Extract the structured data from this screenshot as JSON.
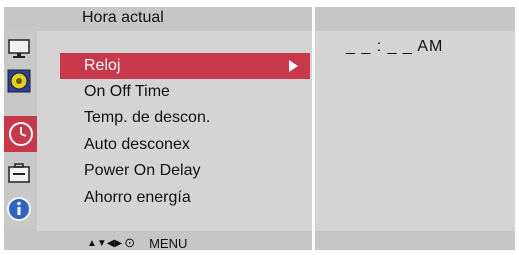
{
  "header": {
    "title": "Hora actual"
  },
  "sidebar": {
    "icons": [
      {
        "name": "monitor-icon",
        "selected": false
      },
      {
        "name": "disc-icon",
        "selected": false
      },
      {
        "name": "clock-icon",
        "selected": true
      },
      {
        "name": "toolbox-icon",
        "selected": false
      },
      {
        "name": "info-icon",
        "selected": false
      }
    ]
  },
  "menu": {
    "items": [
      {
        "label": "Reloj",
        "selected": true
      },
      {
        "label": "On Off Time"
      },
      {
        "label": "Temp. de descon."
      },
      {
        "label": "Auto desconex"
      },
      {
        "label": "Power On Delay"
      },
      {
        "label": "Ahorro energía"
      }
    ]
  },
  "detail": {
    "time": "_ _ : _ _  AM"
  },
  "footer": {
    "nav_glyphs": "▲▼◀▶",
    "enter_glyph": "⊙",
    "menu_label": "MENU"
  },
  "colors": {
    "accent": "#c8374a",
    "panel": "#d4d4d4",
    "bar": "#c6c6c6"
  }
}
